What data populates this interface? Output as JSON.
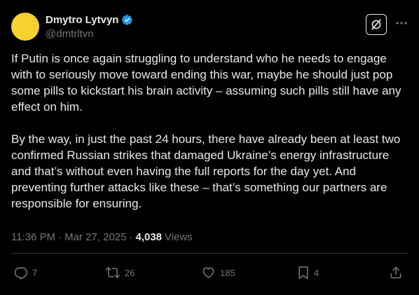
{
  "author": {
    "name": "Dmytro Lytvyn",
    "handle": "@dmtrltvn",
    "verified": true,
    "avatar_color": "#f7d12f",
    "verified_color": "#1d9bf0"
  },
  "tweet": {
    "paragraphs": [
      "If Putin is once again struggling to understand who he needs to engage with to seriously move toward ending this war, maybe he should just pop some pills to kickstart his brain activity – assuming such pills still have any effect on him.",
      "By the way, in just the past 24 hours, there have already been at least two confirmed Russian strikes that damaged Ukraine’s energy infrastructure and that’s without even having the full reports for the day yet. And preventing further attacks like these – that’s something our partners are responsible for ensuring."
    ],
    "time": "11:36 PM",
    "date": "Mar 27, 2025",
    "separator": "·",
    "views_count": "4,038",
    "views_label": "Views"
  },
  "actions": {
    "replies": "7",
    "reposts": "26",
    "likes": "185",
    "bookmarks": "4"
  },
  "icons": {
    "grok": "grok-icon",
    "more": "more-icon",
    "reply": "reply-icon",
    "repost": "repost-icon",
    "like": "like-icon",
    "bookmark": "bookmark-icon",
    "share": "share-icon"
  },
  "colors": {
    "background": "#000000",
    "text": "#e7e9ea",
    "secondary": "#71767b",
    "divider": "#2f3336"
  }
}
